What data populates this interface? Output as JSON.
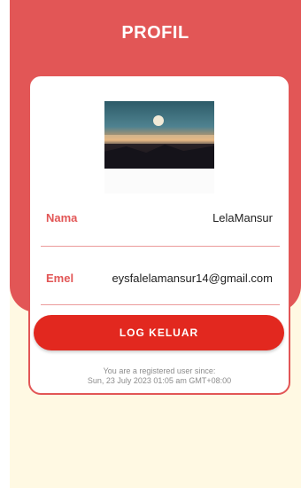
{
  "header": {
    "title": "PROFIL"
  },
  "profile": {
    "photo_icon": "landscape-photo",
    "fields": [
      {
        "label": "Nama",
        "value": "LelaMansur"
      },
      {
        "label": "Emel",
        "value": "eysfalelamansur14@gmail.com"
      }
    ]
  },
  "actions": {
    "logout_label": "LOG KELUAR"
  },
  "footer": {
    "line1": "You are a registered user since:",
    "line2": "Sun, 23 July 2023 01:05 am GMT+08:00"
  },
  "colors": {
    "accent": "#e25656",
    "button": "#e2281f",
    "background": "#fff9e3"
  }
}
